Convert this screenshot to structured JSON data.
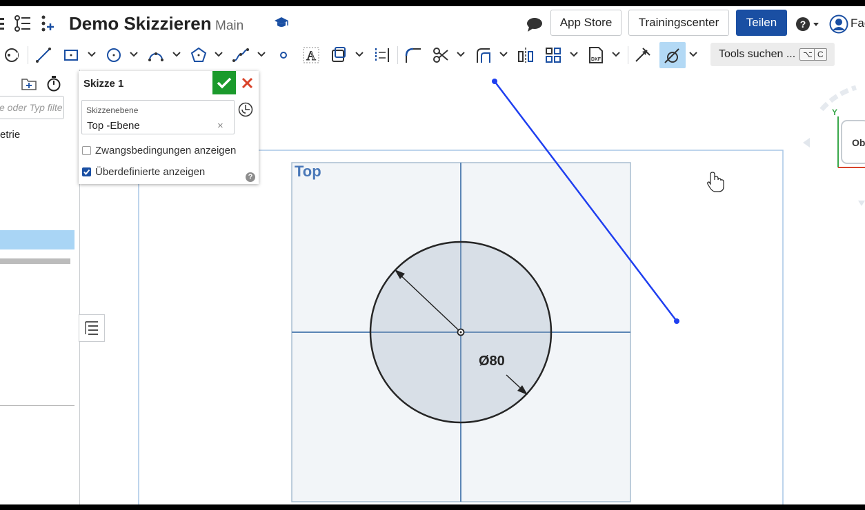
{
  "header": {
    "title": "Demo Skizzieren",
    "branch": "Main",
    "app_store_label": "App Store",
    "training_label": "Trainingscenter",
    "share_label": "Teilen",
    "user_name": "Fac"
  },
  "toolbar": {
    "tools_search_label": "Tools suchen ...",
    "shortcut_key1": "⌥",
    "shortcut_key2": "C"
  },
  "left_panel": {
    "filter_placeholder": "e oder Typ filte",
    "tree_item": "etrie"
  },
  "sketch_dialog": {
    "title": "Skizze 1",
    "plane_label": "Skizzenebene",
    "plane_value": "Top -Ebene",
    "clear_symbol": "×",
    "show_constraints_label": "Zwangsbedingungen anzeigen",
    "show_constraints_checked": false,
    "show_overdefined_label": "Überdefinierte anzeigen",
    "show_overdefined_checked": true,
    "help_symbol": "?"
  },
  "canvas": {
    "plane_name": "Top",
    "diameter_dimension": "Ø80",
    "view_cube_label": "Obe",
    "axis_y_label": "Y"
  },
  "colors": {
    "accent_blue": "#1a4fa3",
    "confirm_green": "#1b9a2c",
    "cancel_red": "#d9432a",
    "sketch_line_blue": "#1f3ff0",
    "active_tool_bg": "#b3d9f5"
  }
}
